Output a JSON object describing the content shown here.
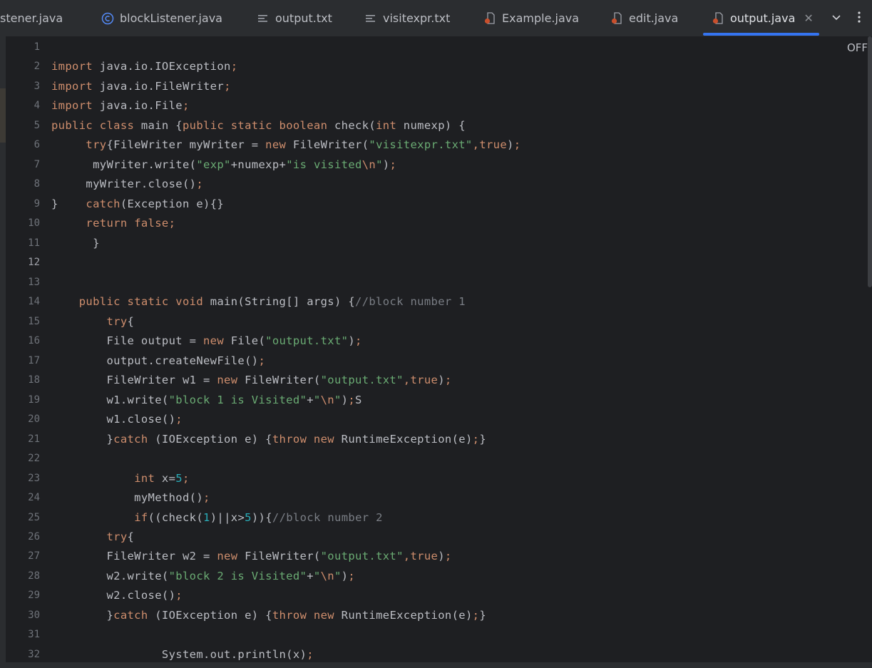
{
  "tabs": [
    {
      "label": "stener.java",
      "icon": "none"
    },
    {
      "label": "blockListener.java",
      "icon": "class-icon"
    },
    {
      "label": "output.txt",
      "icon": "text-file-icon"
    },
    {
      "label": "visitexpr.txt",
      "icon": "text-file-icon"
    },
    {
      "label": "Example.java",
      "icon": "java-file-icon"
    },
    {
      "label": "edit.java",
      "icon": "java-file-icon"
    },
    {
      "label": "output.java",
      "icon": "java-file-icon",
      "active": true
    }
  ],
  "editor": {
    "inspection_label": "OFF",
    "current_line": 12,
    "line_numbers": [
      "1",
      "2",
      "3",
      "4",
      "5",
      "6",
      "7",
      "8",
      "9",
      "10",
      "11",
      "12",
      "13",
      "14",
      "15",
      "16",
      "17",
      "18",
      "19",
      "20",
      "21",
      "22",
      "23",
      "24",
      "25",
      "26",
      "27",
      "28",
      "29",
      "30",
      "31",
      "32"
    ],
    "lines": [
      [],
      [
        [
          "kw",
          "import"
        ],
        [
          "p",
          " java.io.IOException"
        ],
        [
          "semi",
          ";"
        ]
      ],
      [
        [
          "kw",
          "import"
        ],
        [
          "p",
          " java.io.FileWriter"
        ],
        [
          "semi",
          ";"
        ]
      ],
      [
        [
          "kw",
          "import"
        ],
        [
          "p",
          " java.io.File"
        ],
        [
          "semi",
          ";"
        ]
      ],
      [
        [
          "kw",
          "public class"
        ],
        [
          "p",
          " main {"
        ],
        [
          "kw",
          "public static boolean"
        ],
        [
          "p",
          " check("
        ],
        [
          "kw",
          "int"
        ],
        [
          "p",
          " numexp) {"
        ]
      ],
      [
        [
          "p",
          "     "
        ],
        [
          "kw",
          "try"
        ],
        [
          "p",
          "{FileWriter myWriter = "
        ],
        [
          "kw",
          "new"
        ],
        [
          "p",
          " FileWriter("
        ],
        [
          "str",
          "\"visitexpr.txt\""
        ],
        [
          "semi",
          ","
        ],
        [
          "kw",
          "true"
        ],
        [
          "p",
          ")"
        ],
        [
          "semi",
          ";"
        ]
      ],
      [
        [
          "p",
          "      myWriter.write("
        ],
        [
          "str",
          "\"exp\""
        ],
        [
          "p",
          "+numexp+"
        ],
        [
          "str",
          "\"is visited"
        ],
        [
          "esc",
          "\\n"
        ],
        [
          "str",
          "\""
        ],
        [
          "p",
          ")"
        ],
        [
          "semi",
          ";"
        ]
      ],
      [
        [
          "p",
          "     myWriter.close()"
        ],
        [
          "semi",
          ";"
        ]
      ],
      [
        [
          "p",
          "}    "
        ],
        [
          "kw",
          "catch"
        ],
        [
          "p",
          "(Exception e){}"
        ]
      ],
      [
        [
          "p",
          "     "
        ],
        [
          "kw",
          "return false"
        ],
        [
          "semi",
          ";"
        ]
      ],
      [
        [
          "p",
          "      }"
        ]
      ],
      [],
      [],
      [
        [
          "p",
          "    "
        ],
        [
          "kw",
          "public static void"
        ],
        [
          "p",
          " main(String[] args) {"
        ],
        [
          "cmt",
          "//block number 1"
        ]
      ],
      [
        [
          "p",
          "        "
        ],
        [
          "kw",
          "try"
        ],
        [
          "p",
          "{"
        ]
      ],
      [
        [
          "p",
          "        File output = "
        ],
        [
          "kw",
          "new"
        ],
        [
          "p",
          " File("
        ],
        [
          "str",
          "\"output.txt\""
        ],
        [
          "p",
          ")"
        ],
        [
          "semi",
          ";"
        ]
      ],
      [
        [
          "p",
          "        output.createNewFile()"
        ],
        [
          "semi",
          ";"
        ]
      ],
      [
        [
          "p",
          "        FileWriter w1 = "
        ],
        [
          "kw",
          "new"
        ],
        [
          "p",
          " FileWriter("
        ],
        [
          "str",
          "\"output.txt\""
        ],
        [
          "semi",
          ","
        ],
        [
          "kw",
          "true"
        ],
        [
          "p",
          ")"
        ],
        [
          "semi",
          ";"
        ]
      ],
      [
        [
          "p",
          "        w1.write("
        ],
        [
          "str",
          "\"block 1 is Visited\""
        ],
        [
          "p",
          "+"
        ],
        [
          "str",
          "\""
        ],
        [
          "esc",
          "\\n"
        ],
        [
          "str",
          "\""
        ],
        [
          "p",
          ")"
        ],
        [
          "semi",
          ";"
        ],
        [
          "p",
          "S"
        ]
      ],
      [
        [
          "p",
          "        w1.close()"
        ],
        [
          "semi",
          ";"
        ]
      ],
      [
        [
          "p",
          "        }"
        ],
        [
          "kw",
          "catch"
        ],
        [
          "p",
          " (IOException e) {"
        ],
        [
          "kw",
          "throw new"
        ],
        [
          "p",
          " RuntimeException(e)"
        ],
        [
          "semi",
          ";"
        ],
        [
          "p",
          "}"
        ]
      ],
      [],
      [
        [
          "p",
          "            "
        ],
        [
          "kw",
          "int"
        ],
        [
          "p",
          " x="
        ],
        [
          "num",
          "5"
        ],
        [
          "semi",
          ";"
        ]
      ],
      [
        [
          "p",
          "            myMethod()"
        ],
        [
          "semi",
          ";"
        ]
      ],
      [
        [
          "p",
          "            "
        ],
        [
          "kw",
          "if"
        ],
        [
          "p",
          "((check("
        ],
        [
          "num",
          "1"
        ],
        [
          "p",
          ")||x>"
        ],
        [
          "num",
          "5"
        ],
        [
          "p",
          "))"
        ],
        [
          "p",
          "{"
        ],
        [
          "cmt",
          "//block number 2"
        ]
      ],
      [
        [
          "p",
          "        "
        ],
        [
          "kw",
          "try"
        ],
        [
          "p",
          "{"
        ]
      ],
      [
        [
          "p",
          "        FileWriter w2 = "
        ],
        [
          "kw",
          "new"
        ],
        [
          "p",
          " FileWriter("
        ],
        [
          "str",
          "\"output.txt\""
        ],
        [
          "semi",
          ","
        ],
        [
          "kw",
          "true"
        ],
        [
          "p",
          ")"
        ],
        [
          "semi",
          ";"
        ]
      ],
      [
        [
          "p",
          "        w2.write("
        ],
        [
          "str",
          "\"block 2 is Visited\""
        ],
        [
          "p",
          "+"
        ],
        [
          "str",
          "\""
        ],
        [
          "esc",
          "\\n"
        ],
        [
          "str",
          "\""
        ],
        [
          "p",
          ")"
        ],
        [
          "semi",
          ";"
        ]
      ],
      [
        [
          "p",
          "        w2.close()"
        ],
        [
          "semi",
          ";"
        ]
      ],
      [
        [
          "p",
          "        }"
        ],
        [
          "kw",
          "catch"
        ],
        [
          "p",
          " (IOException e) {"
        ],
        [
          "kw",
          "throw new"
        ],
        [
          "p",
          " RuntimeException(e)"
        ],
        [
          "semi",
          ";"
        ],
        [
          "p",
          "}"
        ]
      ],
      [],
      [
        [
          "p",
          "                System.out.println(x)"
        ],
        [
          "semi",
          ";"
        ]
      ]
    ]
  }
}
